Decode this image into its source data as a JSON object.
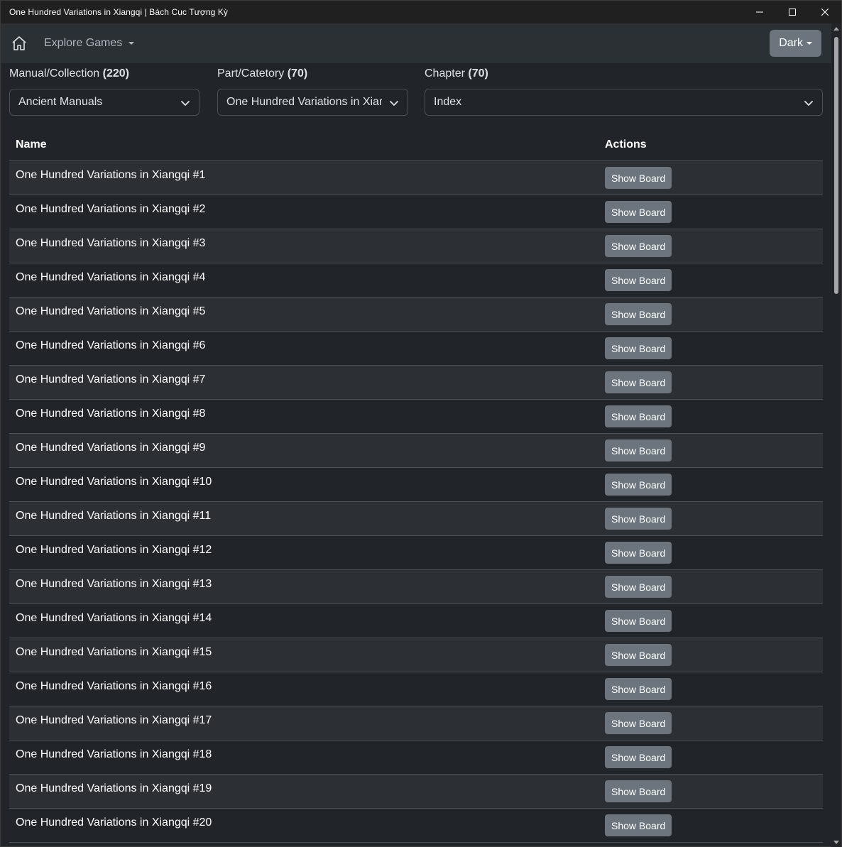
{
  "window": {
    "title": "One Hundred Variations in Xiangqi | Bách Cục Tượng Kỳ"
  },
  "navbar": {
    "explore_label": "Explore Games",
    "theme_label": "Dark"
  },
  "filters": {
    "manual": {
      "label": "Manual/Collection",
      "count": "(220)",
      "value": "Ancient Manuals"
    },
    "part": {
      "label": "Part/Catetory",
      "count": "(70)",
      "value": "One Hundred Variations in Xiangqi"
    },
    "chapter": {
      "label": "Chapter",
      "count": "(70)",
      "value": "Index"
    }
  },
  "table": {
    "columns": {
      "name": "Name",
      "actions": "Actions"
    },
    "action_label": "Show Board",
    "rows": [
      "One Hundred Variations in Xiangqi #1",
      "One Hundred Variations in Xiangqi #2",
      "One Hundred Variations in Xiangqi #3",
      "One Hundred Variations in Xiangqi #4",
      "One Hundred Variations in Xiangqi #5",
      "One Hundred Variations in Xiangqi #6",
      "One Hundred Variations in Xiangqi #7",
      "One Hundred Variations in Xiangqi #8",
      "One Hundred Variations in Xiangqi #9",
      "One Hundred Variations in Xiangqi #10",
      "One Hundred Variations in Xiangqi #11",
      "One Hundred Variations in Xiangqi #12",
      "One Hundred Variations in Xiangqi #13",
      "One Hundred Variations in Xiangqi #14",
      "One Hundred Variations in Xiangqi #15",
      "One Hundred Variations in Xiangqi #16",
      "One Hundred Variations in Xiangqi #17",
      "One Hundred Variations in Xiangqi #18",
      "One Hundred Variations in Xiangqi #19",
      "One Hundred Variations in Xiangqi #20"
    ]
  },
  "icons": {
    "home": "home-icon",
    "minimize": "minimize-icon",
    "maximize": "maximize-icon",
    "close": "close-icon",
    "select_chevron": "chevron-down-icon"
  }
}
